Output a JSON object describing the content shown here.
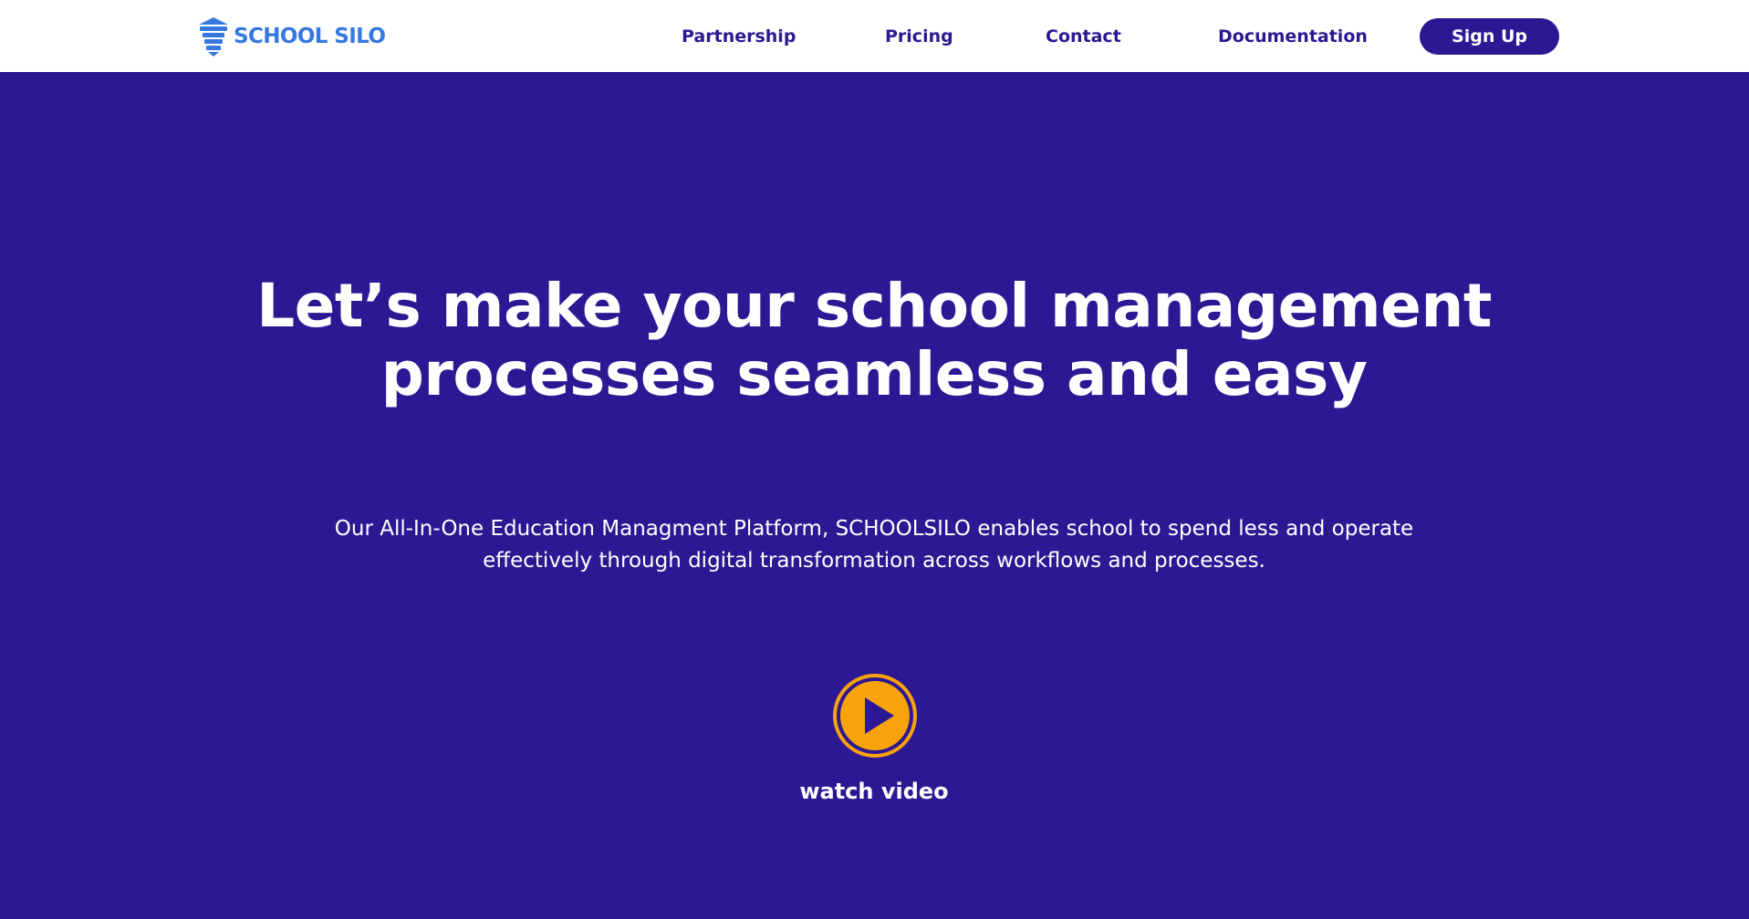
{
  "header": {
    "logo_text": "SCHOOL SILO",
    "nav": [
      {
        "label": "Partnership"
      },
      {
        "label": "Pricing"
      },
      {
        "label": "Contact"
      },
      {
        "label": "Documentation"
      }
    ],
    "signup_label": "Sign Up"
  },
  "hero": {
    "title": "Let’s make your school management processes seamless and easy",
    "subtitle": "Our All-In-One Education Managment Platform, SCHOOLSILO enables school to spend less and operate effectively through digital transformation across workflows and processes.",
    "watch_label": "watch video",
    "play_icon": "play-icon"
  },
  "colors": {
    "brand_purple": "#2d1893",
    "logo_blue": "#3578e0",
    "play_orange": "#f9a30b",
    "white": "#ffffff"
  }
}
